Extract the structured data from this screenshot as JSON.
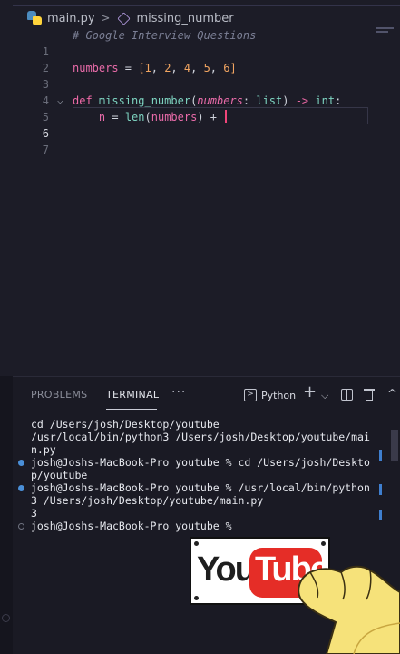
{
  "breadcrumb": {
    "file": "main.py",
    "separator": ">",
    "symbol": "missing_number"
  },
  "editor": {
    "line_numbers": [
      "1",
      "2",
      "3",
      "4",
      "5",
      "6",
      "7"
    ],
    "active_line": 6,
    "line1": {
      "comment": "# Google Interview Questions"
    },
    "line3": {
      "var": "numbers",
      "op": " = ",
      "open": "[",
      "n1": "1",
      "c1": ", ",
      "n2": "2",
      "c2": ", ",
      "n3": "4",
      "c3": ", ",
      "n4": "5",
      "c4": ", ",
      "n5": "6",
      "close": "]"
    },
    "line5": {
      "kw": "def ",
      "fn": "missing_number",
      "open": "(",
      "param": "numbers",
      "colon": ": ",
      "type": "list",
      "close": ")",
      "arrow": " -> ",
      "ret": "int",
      "end": ":"
    },
    "line6": {
      "indent": "    ",
      "var": "n",
      "eq": " = ",
      "call": "len",
      "open": "(",
      "arg": "numbers",
      "close": ")",
      "plus": " + "
    }
  },
  "panel": {
    "tabs": [
      "PROBLEMS",
      "TERMINAL"
    ],
    "active_tab": "TERMINAL",
    "more": "···",
    "terminal_profile": "Python",
    "terminal_icon": ">",
    "add_icon": "+",
    "dropdown_icon": "⌵",
    "collapse_icon": "^"
  },
  "terminal": {
    "lines": [
      "cd /Users/josh/Desktop/youtube",
      "/usr/local/bin/python3 /Users/josh/Desktop/youtube/mai",
      "n.py",
      "josh@Joshs-MacBook-Pro youtube % cd /Users/josh/Deskto",
      "p/youtube",
      "josh@Joshs-MacBook-Pro youtube % /usr/local/bin/python",
      "3 /Users/josh/Desktop/youtube/main.py",
      "3",
      "josh@Joshs-MacBook-Pro youtube % "
    ]
  },
  "sticker": {
    "you": "You",
    "tube": "Tube"
  },
  "colors": {
    "editor_bg": "#1c1c27",
    "keyword": "#f06aa8",
    "function": "#7dd3c0",
    "number": "#f2a561",
    "comment": "#7b7f95",
    "caret": "#f0457a",
    "prompt_dot": "#4a8fd8",
    "youtube_red": "#e52d27"
  },
  "icons": [
    "python-file-icon",
    "symbol-cube-icon",
    "fold-chevron-icon",
    "terminal-icon",
    "plus-icon",
    "chevron-down-icon",
    "split-terminal-icon",
    "trash-icon",
    "chevron-up-icon"
  ]
}
